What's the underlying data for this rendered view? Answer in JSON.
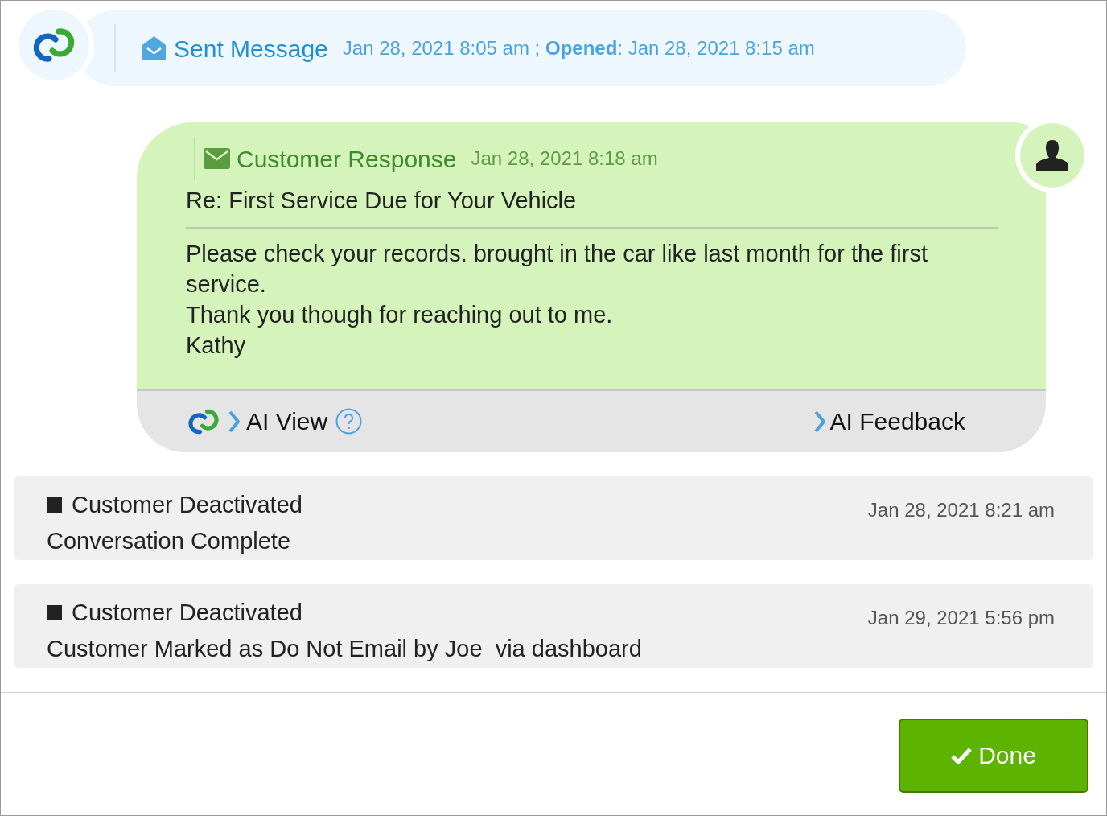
{
  "sent_message": {
    "title": "Sent Message",
    "meta": "Jan 28, 2021 8:05 am ; **Opened**: Jan 28, 2021 8:15 am"
  },
  "customer_response": {
    "title": "Customer Response",
    "time": "Jan 28, 2021 8:18 am",
    "subject": "Re: First Service Due for Your Vehicle",
    "body": [
      "Please check your records. brought in the car like last month for the first service.",
      "Thank you though for reaching out to me.",
      "Kathy"
    ],
    "ai_view": "AI View",
    "ai_feedback": "AI Feedback"
  },
  "events": [
    {
      "title": "Customer Deactivated",
      "detail": "Conversation Complete",
      "time": "Jan 28, 2021 8:21 am"
    },
    {
      "title": "Customer Deactivated",
      "detail": "Customer Marked as Do Not Email by Joe  via dashboard",
      "time": "Jan 29, 2021 5:56 pm"
    }
  ],
  "done_button": "Done"
}
